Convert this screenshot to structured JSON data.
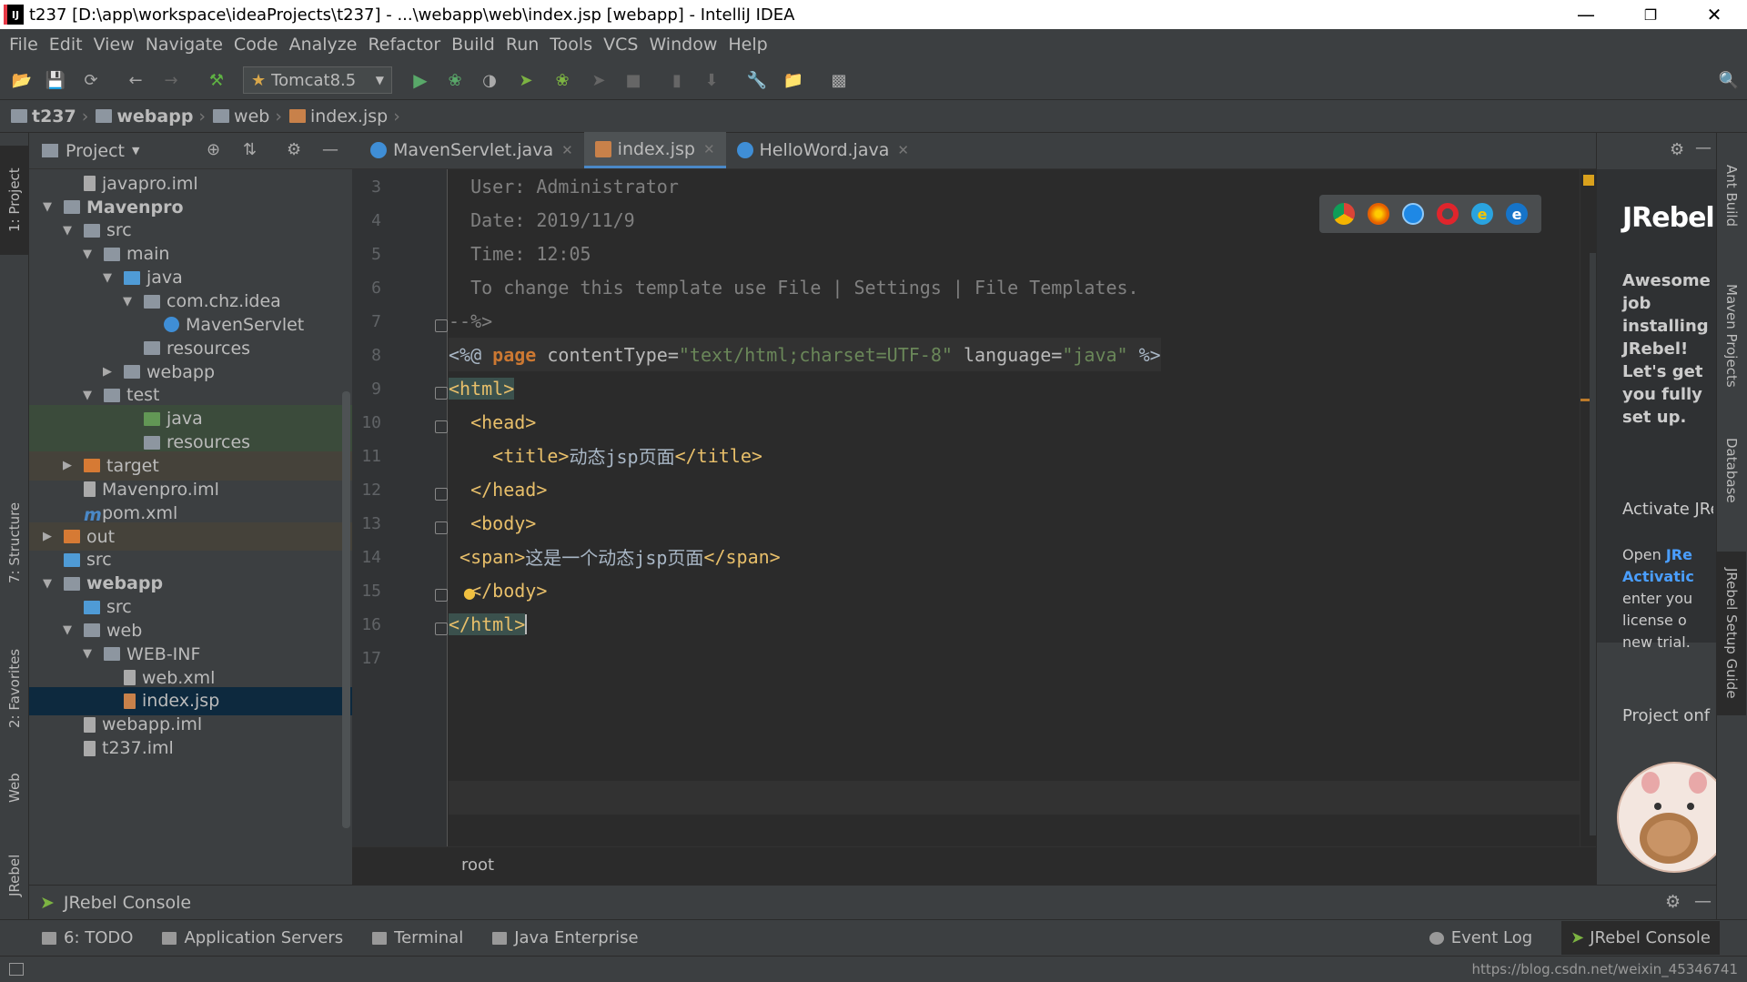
{
  "window": {
    "title": "t237 [D:\\app\\workspace\\ideaProjects\\t237] - ...\\webapp\\web\\index.jsp [webapp] - IntelliJ IDEA"
  },
  "menu": [
    "File",
    "Edit",
    "View",
    "Navigate",
    "Code",
    "Analyze",
    "Refactor",
    "Build",
    "Run",
    "Tools",
    "VCS",
    "Window",
    "Help"
  ],
  "toolbar": {
    "run_config": "Tomcat8.5"
  },
  "breadcrumbs": [
    "t237",
    "webapp",
    "web",
    "index.jsp"
  ],
  "left_stripe": {
    "project": "1: Project",
    "structure": "7: Structure",
    "favorites": "2: Favorites",
    "web": "Web",
    "jrebel": "JRebel"
  },
  "project": {
    "header": "Project",
    "tree": [
      {
        "label": "javapro.iml",
        "icon": "file"
      },
      {
        "label": "Mavenpro",
        "icon": "folder",
        "bold": true
      },
      {
        "label": "src",
        "icon": "folder"
      },
      {
        "label": "main",
        "icon": "folder"
      },
      {
        "label": "java",
        "icon": "folder-blue"
      },
      {
        "label": "com.chz.idea",
        "icon": "folder"
      },
      {
        "label": "MavenServlet",
        "icon": "class"
      },
      {
        "label": "resources",
        "icon": "folder"
      },
      {
        "label": "webapp",
        "icon": "folder"
      },
      {
        "label": "test",
        "icon": "folder"
      },
      {
        "label": "java",
        "icon": "folder-green"
      },
      {
        "label": "resources",
        "icon": "folder"
      },
      {
        "label": "target",
        "icon": "folder-orange"
      },
      {
        "label": "Mavenpro.iml",
        "icon": "file"
      },
      {
        "label": "pom.xml",
        "icon": "maven"
      },
      {
        "label": "out",
        "icon": "folder-orange"
      },
      {
        "label": "src",
        "icon": "folder-blue"
      },
      {
        "label": "webapp",
        "icon": "folder",
        "bold": true
      },
      {
        "label": "src",
        "icon": "folder-blue"
      },
      {
        "label": "web",
        "icon": "folder"
      },
      {
        "label": "WEB-INF",
        "icon": "folder"
      },
      {
        "label": "web.xml",
        "icon": "file"
      },
      {
        "label": "index.jsp",
        "icon": "jsp"
      },
      {
        "label": "webapp.iml",
        "icon": "file"
      },
      {
        "label": "t237.iml",
        "icon": "file"
      }
    ]
  },
  "editor_tabs": [
    {
      "label": "MavenServlet.java",
      "active": false
    },
    {
      "label": "index.jsp",
      "active": true
    },
    {
      "label": "HelloWord.java",
      "active": false
    }
  ],
  "code": {
    "line_numbers": [
      "3",
      "4",
      "5",
      "6",
      "7",
      "8",
      "9",
      "10",
      "11",
      "12",
      "13",
      "14",
      "15",
      "16",
      "17"
    ],
    "l3": "  User: Administrator",
    "l4": "  Date: 2019/11/9",
    "l5": "  Time: 12:05",
    "l6": "  To change this template use File | Settings | File Templates.",
    "l7": "--%>",
    "l8_a": "<%@ ",
    "l8_b": "page",
    "l8_c": " contentType=",
    "l8_d": "\"text/html;charset=UTF-8\"",
    "l8_e": " language=",
    "l8_f": "\"java\"",
    "l8_g": " %>",
    "l9": "<html>",
    "l10": "  <head>",
    "l11_a": "    <title>",
    "l11_b": "动态jsp页面",
    "l11_c": "</title>",
    "l12": "  </head>",
    "l13": "  <body>",
    "l14_a": " <span>",
    "l14_b": "这是一个动态jsp页面",
    "l14_c": "</span>",
    "l15": "  </body>",
    "l16": "</html>"
  },
  "editor_status": "root",
  "jrebel": {
    "logo": "JRebel",
    "message": "Awesome job installing JRebel! Let's get you fully set up.",
    "activate": "Activate JRe",
    "open": "Open ",
    "open_link": "JRe",
    "activation": "Activatic",
    "enter1": "enter you",
    "enter2": "license o",
    "enter3": "new trial.",
    "project_conf": "Project onf"
  },
  "right_stripe": {
    "ant": "Ant Build",
    "maven": "Maven Projects",
    "database": "Database",
    "jrebel_guide": "JRebel Setup Guide"
  },
  "console": {
    "label": "JRebel Console"
  },
  "bottom_tabs": [
    "6: TODO",
    "Application Servers",
    "Terminal",
    "Java Enterprise"
  ],
  "bottom_right_tabs": [
    "Event Log",
    "JRebel Console"
  ],
  "statusbar": {
    "right": "https://blog.csdn.net/weixin_45346741"
  }
}
